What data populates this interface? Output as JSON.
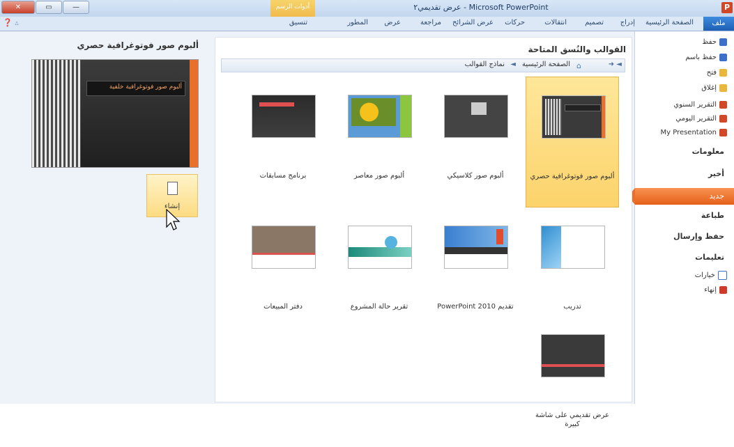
{
  "window": {
    "title": "عرض تقديمي٢ - Microsoft PowerPoint",
    "contextual_tab_group": "أدوات الرسم",
    "controls": [
      "✕",
      "▭",
      "—"
    ]
  },
  "ribbon": {
    "file_tab": "ملف",
    "tabs": [
      "الصفحة الرئيسية",
      "إدراج",
      "تصميم",
      "انتقالات",
      "حركات",
      "عرض الشرائح",
      "مراجعة",
      "عرض",
      "المطور",
      "تنسيق"
    ]
  },
  "nav": {
    "save": "حفظ",
    "save_as": "حفظ باسم",
    "open": "فتح",
    "close": "إغلاق",
    "recent_files": [
      "التقرير السنوي",
      "التقرير اليومي",
      "My Presentation"
    ],
    "info": "معلومات",
    "recent": "أخير",
    "new": "جديد",
    "print": "طباعة",
    "save_send": "حفظ وإرسال",
    "help": "تعليمات",
    "options": "خيارات",
    "exit": "إنهاء"
  },
  "templates": {
    "heading": "القوالب والنُسق المتاحة",
    "breadcrumb_home": "الصفحة الرئيسية",
    "breadcrumb_current": "نماذج القوالب",
    "items": [
      {
        "label": "ألبوم صور فوتوغرافية حصري",
        "selected": true
      },
      {
        "label": "ألبوم صور كلاسيكي"
      },
      {
        "label": "ألبوم صور معاصر"
      },
      {
        "label": "برنامج مسابقات"
      },
      {
        "label": "تدريب"
      },
      {
        "label": "تقديم PowerPoint 2010"
      },
      {
        "label": "تقرير حالة المشروع"
      },
      {
        "label": "دفتر المبيعات"
      },
      {
        "label": "عرض تقديمي على شاشة كبيرة"
      }
    ]
  },
  "preview": {
    "title": "ألبوم صور فوتوغرافية حصري",
    "slide_text": "ألبوم صور فوتوغرافية خلفية",
    "create_label": "إنشاء"
  },
  "colors": {
    "accent_orange": "#e96f2a",
    "selection_yellow": "#fcd36b",
    "ribbon_blue": "#1d5fb4"
  }
}
